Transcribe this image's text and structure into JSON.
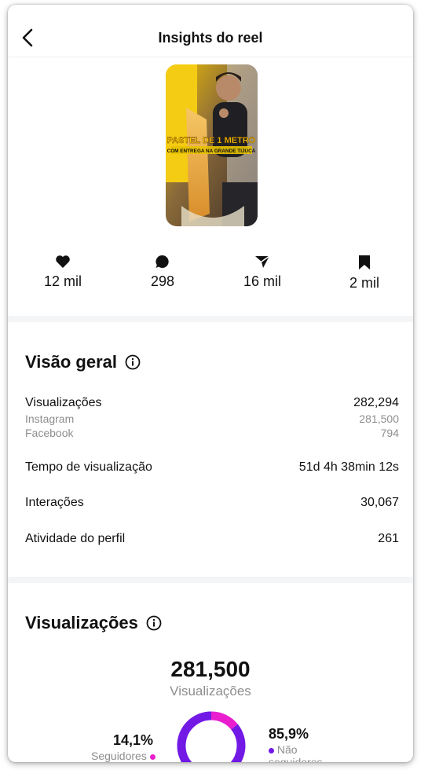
{
  "header": {
    "title": "Insights do reel",
    "back_icon": "chevron-left-icon"
  },
  "thumbnail": {
    "headline": "PASTEL DE 1 METRO",
    "subline": "COM ENTREGA NA GRANDE TIJUCA"
  },
  "stats": [
    {
      "icon": "heart-icon",
      "value": "12 mil"
    },
    {
      "icon": "comment-icon",
      "value": "298"
    },
    {
      "icon": "share-icon",
      "value": "16 mil"
    },
    {
      "icon": "bookmark-icon",
      "value": "2 mil"
    }
  ],
  "overview": {
    "title": "Visão geral",
    "rows": {
      "views": {
        "label": "Visualizações",
        "value": "282,294"
      },
      "instagram": {
        "label": "Instagram",
        "value": "281,500"
      },
      "facebook": {
        "label": "Facebook",
        "value": "794"
      },
      "watch_time": {
        "label": "Tempo de visualização",
        "value": "51d 4h 38min 12s"
      },
      "interactions": {
        "label": "Interações",
        "value": "30,067"
      },
      "profile_activity": {
        "label": "Atividade do perfil",
        "value": "261"
      }
    }
  },
  "views_section": {
    "title": "Visualizações",
    "total": "281,500",
    "total_label": "Visualizações",
    "followers": {
      "percent": "14,1%",
      "label": "Seguidores",
      "color": "#e81ecf",
      "fraction": 0.141
    },
    "non_followers": {
      "percent": "85,9%",
      "label": "Não seguidores",
      "color": "#7219e6",
      "fraction": 0.859
    }
  },
  "colors": {
    "separator": "#f4f5f6",
    "muted_text": "#8e8e8e"
  }
}
